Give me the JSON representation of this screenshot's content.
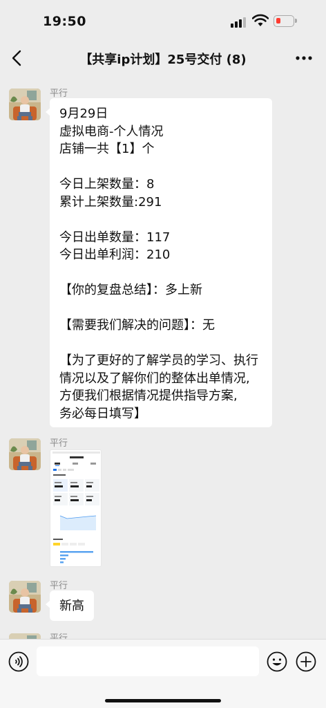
{
  "status_bar": {
    "time": "19:50"
  },
  "chat": {
    "title": "【共享ip计划】25号交付 (8)"
  },
  "messages": [
    {
      "sender": "平行",
      "type": "text",
      "lines": [
        "9月29日",
        "虚拟电商-个人情况",
        "店铺一共【1】个",
        "",
        "今日上架数量：8",
        "累计上架数量:291",
        "",
        "今日出单数量：117",
        "今日出单利润：210",
        "",
        "【你的复盘总结】：多上新",
        "",
        "【需要我们解决的问题】：无",
        "",
        "【为了更好的了解学员的学习、执行",
        "情况以及了解你们的整体出单情况,",
        "方便我们根据情况提供指导方案,",
        "务必每日填写】"
      ]
    },
    {
      "sender": "平行",
      "type": "image"
    },
    {
      "sender": "平行",
      "type": "text",
      "text": "新高"
    },
    {
      "sender": "平行",
      "type": "text"
    }
  ],
  "icons": {
    "back": "chevron-left-icon",
    "more": "ellipsis-icon",
    "voice": "voice-icon",
    "emoji": "emoji-icon",
    "plus": "plus-icon"
  },
  "colors": {
    "background": "#ededed",
    "bubble": "#ffffff",
    "battery_low": "#ff3b30"
  }
}
